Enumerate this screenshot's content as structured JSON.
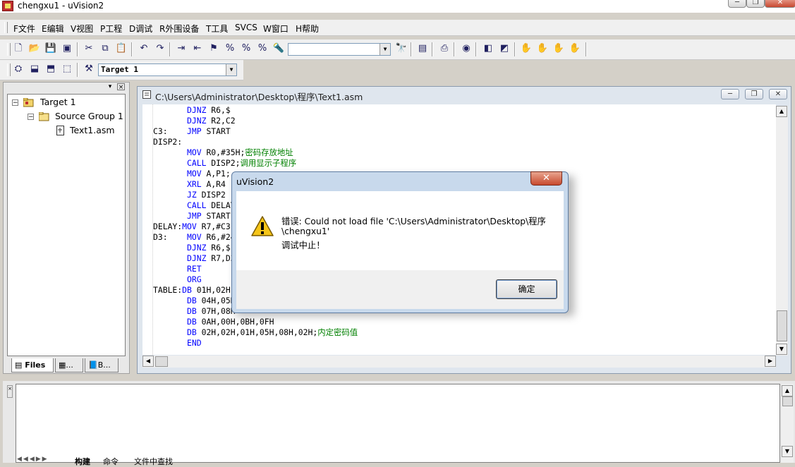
{
  "window": {
    "title": "chengxu1  - uVision2",
    "minimize_glyph": "─",
    "restore_glyph": "❐",
    "close_glyph": "✕"
  },
  "menu": [
    "F文件",
    "E编辑",
    "V视图",
    "P工程",
    "D调试",
    "R外围设备",
    "T工具",
    "SVCS",
    "W窗口",
    "H帮助"
  ],
  "toolbar": {
    "find_value": "",
    "target_value": "Target 1",
    "dropdown_glyph": "▼"
  },
  "project": {
    "tree": {
      "target": "Target 1",
      "group": "Source Group 1",
      "file": "Text1.asm"
    },
    "tabs": [
      "Files",
      "...",
      "B..."
    ]
  },
  "editor": {
    "title": "C:\\Users\\Administrator\\Desktop\\程序\\Text1.asm",
    "lines": [
      [
        {
          "t": "       "
        },
        {
          "t": "DJNZ",
          "c": "kw"
        },
        {
          "t": " R6,$"
        }
      ],
      [
        {
          "t": "       "
        },
        {
          "t": "DJNZ",
          "c": "kw"
        },
        {
          "t": " R2,C2"
        }
      ],
      [
        {
          "t": "C3:    "
        },
        {
          "t": "JMP",
          "c": "kw"
        },
        {
          "t": " START"
        }
      ],
      [
        {
          "t": "DISP2:"
        }
      ],
      [
        {
          "t": "       "
        },
        {
          "t": "MOV",
          "c": "kw"
        },
        {
          "t": " R0,#35H;"
        },
        {
          "t": "密码存放地址",
          "c": "cm"
        }
      ],
      [
        {
          "t": "       "
        },
        {
          "t": "CALL",
          "c": "kw"
        },
        {
          "t": " DISP2;"
        },
        {
          "t": "调用显示子程序",
          "c": "cm"
        }
      ],
      [
        {
          "t": "       "
        },
        {
          "t": "MOV",
          "c": "kw"
        },
        {
          "t": " A,P1;"
        }
      ],
      [
        {
          "t": "       "
        },
        {
          "t": "XRL",
          "c": "kw"
        },
        {
          "t": " A,R4"
        }
      ],
      [
        {
          "t": "       "
        },
        {
          "t": "JZ",
          "c": "kw"
        },
        {
          "t": " DISP2"
        }
      ],
      [
        {
          "t": "       "
        },
        {
          "t": "CALL",
          "c": "kw"
        },
        {
          "t": " DELAY"
        }
      ],
      [
        {
          "t": "       "
        },
        {
          "t": "JMP",
          "c": "kw"
        },
        {
          "t": " START"
        }
      ],
      [
        {
          "t": "DELAY:"
        },
        {
          "t": "MOV",
          "c": "kw"
        },
        {
          "t": " R7,#C3"
        }
      ],
      [
        {
          "t": "D3:    "
        },
        {
          "t": "MOV",
          "c": "kw"
        },
        {
          "t": " R6,#24"
        }
      ],
      [
        {
          "t": "       "
        },
        {
          "t": "DJNZ",
          "c": "kw"
        },
        {
          "t": " R6,$"
        }
      ],
      [
        {
          "t": "       "
        },
        {
          "t": "DJNZ",
          "c": "kw"
        },
        {
          "t": " R7,D3"
        }
      ],
      [
        {
          "t": "       "
        },
        {
          "t": "RET",
          "c": "kw"
        }
      ],
      [
        {
          "t": "       "
        },
        {
          "t": "ORG",
          "c": "kw"
        }
      ],
      [
        {
          "t": "TABLE:"
        },
        {
          "t": "DB",
          "c": "kw"
        },
        {
          "t": " 01H,02H"
        }
      ],
      [
        {
          "t": "       "
        },
        {
          "t": "DB",
          "c": "kw"
        },
        {
          "t": " 04H,05H"
        }
      ],
      [
        {
          "t": "       "
        },
        {
          "t": "DB",
          "c": "kw"
        },
        {
          "t": " 07H,08H"
        }
      ],
      [
        {
          "t": "       "
        },
        {
          "t": "DB",
          "c": "kw"
        },
        {
          "t": " 0AH,00H,0BH,0FH"
        }
      ],
      [
        {
          "t": "       "
        },
        {
          "t": "DB",
          "c": "kw"
        },
        {
          "t": " 02H,02H,01H,05H,08H,02H;"
        },
        {
          "t": "内定密码值",
          "c": "cm"
        }
      ],
      [
        {
          "t": "       "
        },
        {
          "t": "END",
          "c": "kw"
        }
      ]
    ]
  },
  "output": {
    "tabs": [
      "构建",
      "命令",
      "文件中查找"
    ]
  },
  "dialog": {
    "title": "uVision2",
    "close_glyph": "✕",
    "message_line1": "错误: Could not load file 'C:\\Users\\Administrator\\Desktop\\程序",
    "message_line2": "\\chengxu1'",
    "message_line3": "调试中止！",
    "ok_label": "确定",
    "icon": "warning-icon"
  }
}
